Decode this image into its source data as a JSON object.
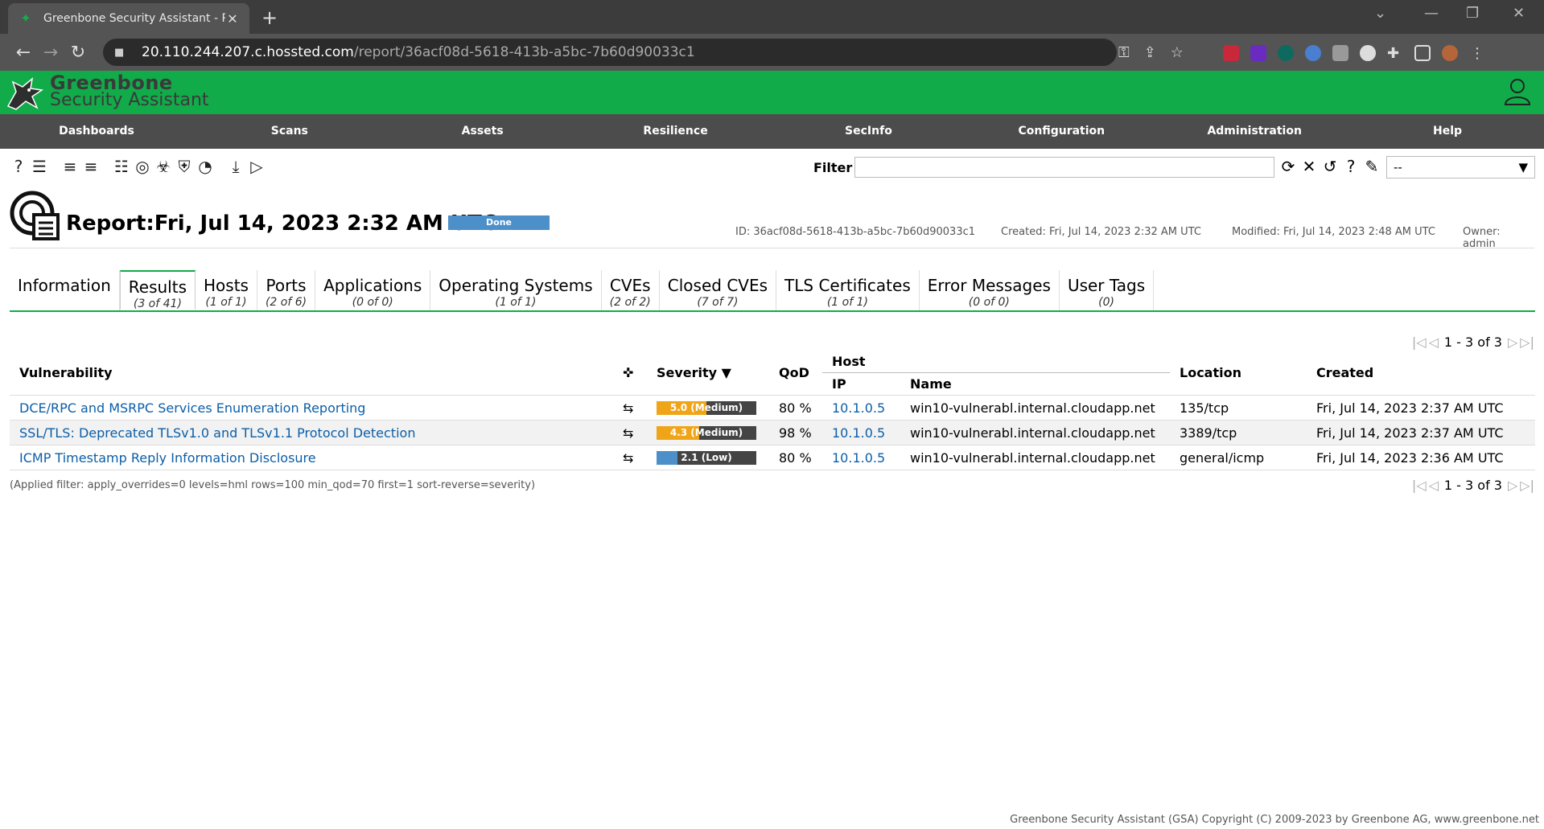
{
  "browser": {
    "tab_title": "Greenbone Security Assistant - R",
    "url_host": "20.110.244.207.c.hossted.com",
    "url_path": "/report/36acf08d-5618-413b-a5bc-7b60d90033c1"
  },
  "app": {
    "brand_line1": "Greenbone",
    "brand_line2": "Security Assistant",
    "menu": [
      "Dashboards",
      "Scans",
      "Assets",
      "Resilience",
      "SecInfo",
      "Configuration",
      "Administration",
      "Help"
    ]
  },
  "filter": {
    "label": "Filter",
    "value": "",
    "select_value": "--"
  },
  "report": {
    "title": "Report:Fri, Jul 14, 2023 2:32 AM UTC",
    "status": "Done",
    "status_progress_percent": 100,
    "id": "ID: 36acf08d-5618-413b-a5bc-7b60d90033c1",
    "created": "Created: Fri, Jul 14, 2023 2:32 AM UTC",
    "modified": "Modified: Fri, Jul 14, 2023 2:48 AM UTC",
    "owner": "Owner: admin"
  },
  "tabs": [
    {
      "name": "Information",
      "count": ""
    },
    {
      "name": "Results",
      "count": "(3 of 41)"
    },
    {
      "name": "Hosts",
      "count": "(1 of 1)"
    },
    {
      "name": "Ports",
      "count": "(2 of 6)"
    },
    {
      "name": "Applications",
      "count": "(0 of 0)"
    },
    {
      "name": "Operating Systems",
      "count": "(1 of 1)"
    },
    {
      "name": "CVEs",
      "count": "(2 of 2)"
    },
    {
      "name": "Closed CVEs",
      "count": "(7 of 7)"
    },
    {
      "name": "TLS Certificates",
      "count": "(1 of 1)"
    },
    {
      "name": "Error Messages",
      "count": "(0 of 0)"
    },
    {
      "name": "User Tags",
      "count": "(0)"
    }
  ],
  "pagination": {
    "text": "1 - 3 of 3"
  },
  "table": {
    "headers": {
      "vulnerability": "Vulnerability",
      "severity": "Severity ▼",
      "qod": "QoD",
      "host": "Host",
      "ip": "IP",
      "name": "Name",
      "location": "Location",
      "created": "Created"
    },
    "rows": [
      {
        "vulnerability": "DCE/RPC and MSRPC Services Enumeration Reporting",
        "severity_value": 5.0,
        "severity_label": "5.0 (Medium)",
        "severity_color": "#f0a519",
        "qod": "80 %",
        "ip": "10.1.0.5",
        "name": "win10-vulnerabl.internal.cloudapp.net",
        "location": "135/tcp",
        "created": "Fri, Jul 14, 2023 2:37 AM UTC"
      },
      {
        "vulnerability": "SSL/TLS: Deprecated TLSv1.0 and TLSv1.1 Protocol Detection",
        "severity_value": 4.3,
        "severity_label": "4.3 (Medium)",
        "severity_color": "#f0a519",
        "qod": "98 %",
        "ip": "10.1.0.5",
        "name": "win10-vulnerabl.internal.cloudapp.net",
        "location": "3389/tcp",
        "created": "Fri, Jul 14, 2023 2:37 AM UTC"
      },
      {
        "vulnerability": "ICMP Timestamp Reply Information Disclosure",
        "severity_value": 2.1,
        "severity_label": "2.1 (Low)",
        "severity_color": "#4c8fc9",
        "qod": "80 %",
        "ip": "10.1.0.5",
        "name": "win10-vulnerabl.internal.cloudapp.net",
        "location": "general/icmp",
        "created": "Fri, Jul 14, 2023 2:36 AM UTC"
      }
    ]
  },
  "applied_filter": "(Applied filter: apply_overrides=0 levels=hml rows=100 min_qod=70 first=1 sort-reverse=severity)",
  "footer": "Greenbone Security Assistant (GSA) Copyright (C) 2009-2023 by Greenbone AG, www.greenbone.net",
  "colors": {
    "brand_green": "#11ab4a",
    "menu_bg": "#4c4c4c",
    "link": "#0b5ea8",
    "medium": "#f0a519",
    "low": "#4c8fc9"
  }
}
